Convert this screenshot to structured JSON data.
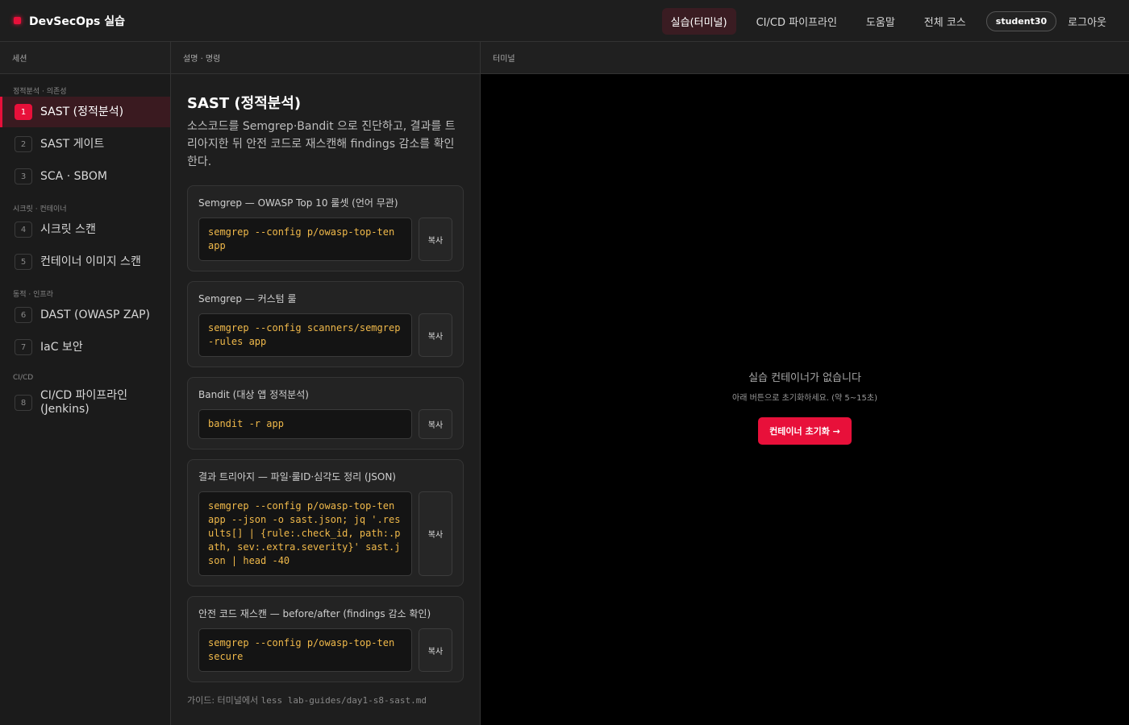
{
  "brand": {
    "title": "DevSecOps 실습"
  },
  "nav": {
    "items": [
      "실습(터미널)",
      "CI/CD 파이프라인",
      "도움말",
      "전체 코스"
    ],
    "user": "student30",
    "logout": "로그아웃"
  },
  "colors": {
    "accent": "#e8103a",
    "code": "#f0b94a"
  },
  "sidebar": {
    "header": "세션",
    "groups": [
      {
        "label": "정적분석 · 의존성",
        "items": [
          {
            "num": "1",
            "label": "SAST (정적분석)"
          },
          {
            "num": "2",
            "label": "SAST 게이트"
          },
          {
            "num": "3",
            "label": "SCA · SBOM"
          }
        ]
      },
      {
        "label": "시크릿 · 컨테이너",
        "items": [
          {
            "num": "4",
            "label": "시크릿 스캔"
          },
          {
            "num": "5",
            "label": "컨테이너 이미지 스캔"
          }
        ]
      },
      {
        "label": "동적 · 인프라",
        "items": [
          {
            "num": "6",
            "label": "DAST (OWASP ZAP)"
          },
          {
            "num": "7",
            "label": "IaC 보안"
          }
        ]
      },
      {
        "label": "CI/CD",
        "items": [
          {
            "num": "8",
            "label": "CI/CD 파이프라인 (Jenkins)"
          }
        ]
      }
    ]
  },
  "guide_pane": {
    "header": "설명 · 명령",
    "title": "SAST (정적분석)",
    "description": "소스코드를 Semgrep·Bandit 으로 진단하고, 결과를 트리아지한 뒤 안전 코드로 재스캔해 findings 감소를 확인한다.",
    "copy_label": "복사",
    "cards": [
      {
        "title": "Semgrep — OWASP Top 10 룰셋 (언어 무관)",
        "code": "semgrep --config p/owasp-top-ten app"
      },
      {
        "title": "Semgrep — 커스텀 룰",
        "code": "semgrep --config scanners/semgrep-rules app"
      },
      {
        "title": "Bandit (대상 앱 정적분석)",
        "code": "bandit -r app"
      },
      {
        "title": "결과 트리아지 — 파일·룰ID·심각도 정리 (JSON)",
        "code": "semgrep --config p/owasp-top-ten app --json -o sast.json; jq '.results[] | {rule:.check_id, path:.path, sev:.extra.severity}' sast.json | head -40"
      },
      {
        "title": "안전 코드 재스캔 — before/after (findings 감소 확인)",
        "code": "semgrep --config p/owasp-top-ten secure"
      }
    ],
    "guide_prefix": "가이드: 터미널에서",
    "guide_command": "less lab-guides/day1-s8-sast.md"
  },
  "terminal": {
    "header": "터미널",
    "empty_title": "실습 컨테이너가 없습니다",
    "empty_sub": "아래 버튼으로 초기화하세요. (약 5~15초)",
    "reset_button": "컨테이너 초기화 →"
  }
}
